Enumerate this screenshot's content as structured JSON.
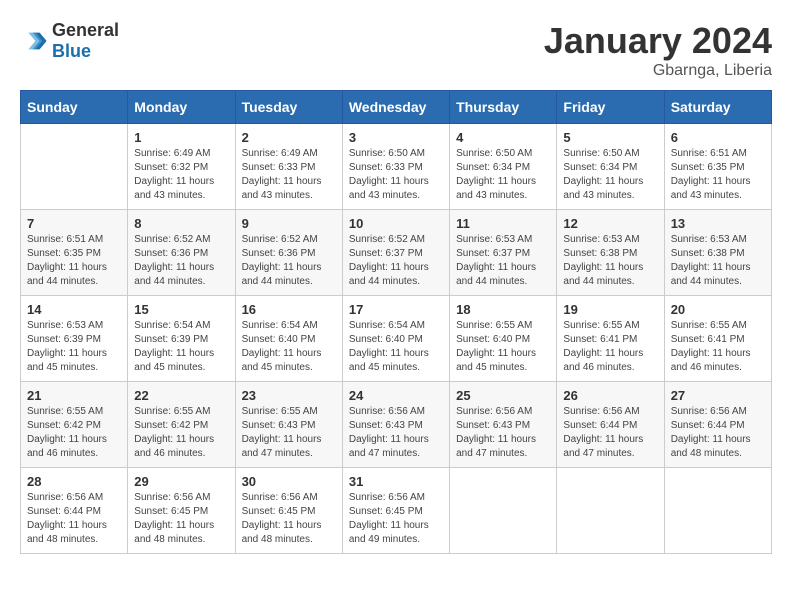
{
  "header": {
    "logo_general": "General",
    "logo_blue": "Blue",
    "month_title": "January 2024",
    "location": "Gbarnga, Liberia"
  },
  "calendar": {
    "days_of_week": [
      "Sunday",
      "Monday",
      "Tuesday",
      "Wednesday",
      "Thursday",
      "Friday",
      "Saturday"
    ],
    "weeks": [
      [
        {
          "day": "",
          "info": ""
        },
        {
          "day": "1",
          "info": "Sunrise: 6:49 AM\nSunset: 6:32 PM\nDaylight: 11 hours\nand 43 minutes."
        },
        {
          "day": "2",
          "info": "Sunrise: 6:49 AM\nSunset: 6:33 PM\nDaylight: 11 hours\nand 43 minutes."
        },
        {
          "day": "3",
          "info": "Sunrise: 6:50 AM\nSunset: 6:33 PM\nDaylight: 11 hours\nand 43 minutes."
        },
        {
          "day": "4",
          "info": "Sunrise: 6:50 AM\nSunset: 6:34 PM\nDaylight: 11 hours\nand 43 minutes."
        },
        {
          "day": "5",
          "info": "Sunrise: 6:50 AM\nSunset: 6:34 PM\nDaylight: 11 hours\nand 43 minutes."
        },
        {
          "day": "6",
          "info": "Sunrise: 6:51 AM\nSunset: 6:35 PM\nDaylight: 11 hours\nand 43 minutes."
        }
      ],
      [
        {
          "day": "7",
          "info": "Sunrise: 6:51 AM\nSunset: 6:35 PM\nDaylight: 11 hours\nand 44 minutes."
        },
        {
          "day": "8",
          "info": "Sunrise: 6:52 AM\nSunset: 6:36 PM\nDaylight: 11 hours\nand 44 minutes."
        },
        {
          "day": "9",
          "info": "Sunrise: 6:52 AM\nSunset: 6:36 PM\nDaylight: 11 hours\nand 44 minutes."
        },
        {
          "day": "10",
          "info": "Sunrise: 6:52 AM\nSunset: 6:37 PM\nDaylight: 11 hours\nand 44 minutes."
        },
        {
          "day": "11",
          "info": "Sunrise: 6:53 AM\nSunset: 6:37 PM\nDaylight: 11 hours\nand 44 minutes."
        },
        {
          "day": "12",
          "info": "Sunrise: 6:53 AM\nSunset: 6:38 PM\nDaylight: 11 hours\nand 44 minutes."
        },
        {
          "day": "13",
          "info": "Sunrise: 6:53 AM\nSunset: 6:38 PM\nDaylight: 11 hours\nand 44 minutes."
        }
      ],
      [
        {
          "day": "14",
          "info": "Sunrise: 6:53 AM\nSunset: 6:39 PM\nDaylight: 11 hours\nand 45 minutes."
        },
        {
          "day": "15",
          "info": "Sunrise: 6:54 AM\nSunset: 6:39 PM\nDaylight: 11 hours\nand 45 minutes."
        },
        {
          "day": "16",
          "info": "Sunrise: 6:54 AM\nSunset: 6:40 PM\nDaylight: 11 hours\nand 45 minutes."
        },
        {
          "day": "17",
          "info": "Sunrise: 6:54 AM\nSunset: 6:40 PM\nDaylight: 11 hours\nand 45 minutes."
        },
        {
          "day": "18",
          "info": "Sunrise: 6:55 AM\nSunset: 6:40 PM\nDaylight: 11 hours\nand 45 minutes."
        },
        {
          "day": "19",
          "info": "Sunrise: 6:55 AM\nSunset: 6:41 PM\nDaylight: 11 hours\nand 46 minutes."
        },
        {
          "day": "20",
          "info": "Sunrise: 6:55 AM\nSunset: 6:41 PM\nDaylight: 11 hours\nand 46 minutes."
        }
      ],
      [
        {
          "day": "21",
          "info": "Sunrise: 6:55 AM\nSunset: 6:42 PM\nDaylight: 11 hours\nand 46 minutes."
        },
        {
          "day": "22",
          "info": "Sunrise: 6:55 AM\nSunset: 6:42 PM\nDaylight: 11 hours\nand 46 minutes."
        },
        {
          "day": "23",
          "info": "Sunrise: 6:55 AM\nSunset: 6:43 PM\nDaylight: 11 hours\nand 47 minutes."
        },
        {
          "day": "24",
          "info": "Sunrise: 6:56 AM\nSunset: 6:43 PM\nDaylight: 11 hours\nand 47 minutes."
        },
        {
          "day": "25",
          "info": "Sunrise: 6:56 AM\nSunset: 6:43 PM\nDaylight: 11 hours\nand 47 minutes."
        },
        {
          "day": "26",
          "info": "Sunrise: 6:56 AM\nSunset: 6:44 PM\nDaylight: 11 hours\nand 47 minutes."
        },
        {
          "day": "27",
          "info": "Sunrise: 6:56 AM\nSunset: 6:44 PM\nDaylight: 11 hours\nand 48 minutes."
        }
      ],
      [
        {
          "day": "28",
          "info": "Sunrise: 6:56 AM\nSunset: 6:44 PM\nDaylight: 11 hours\nand 48 minutes."
        },
        {
          "day": "29",
          "info": "Sunrise: 6:56 AM\nSunset: 6:45 PM\nDaylight: 11 hours\nand 48 minutes."
        },
        {
          "day": "30",
          "info": "Sunrise: 6:56 AM\nSunset: 6:45 PM\nDaylight: 11 hours\nand 48 minutes."
        },
        {
          "day": "31",
          "info": "Sunrise: 6:56 AM\nSunset: 6:45 PM\nDaylight: 11 hours\nand 49 minutes."
        },
        {
          "day": "",
          "info": ""
        },
        {
          "day": "",
          "info": ""
        },
        {
          "day": "",
          "info": ""
        }
      ]
    ]
  }
}
